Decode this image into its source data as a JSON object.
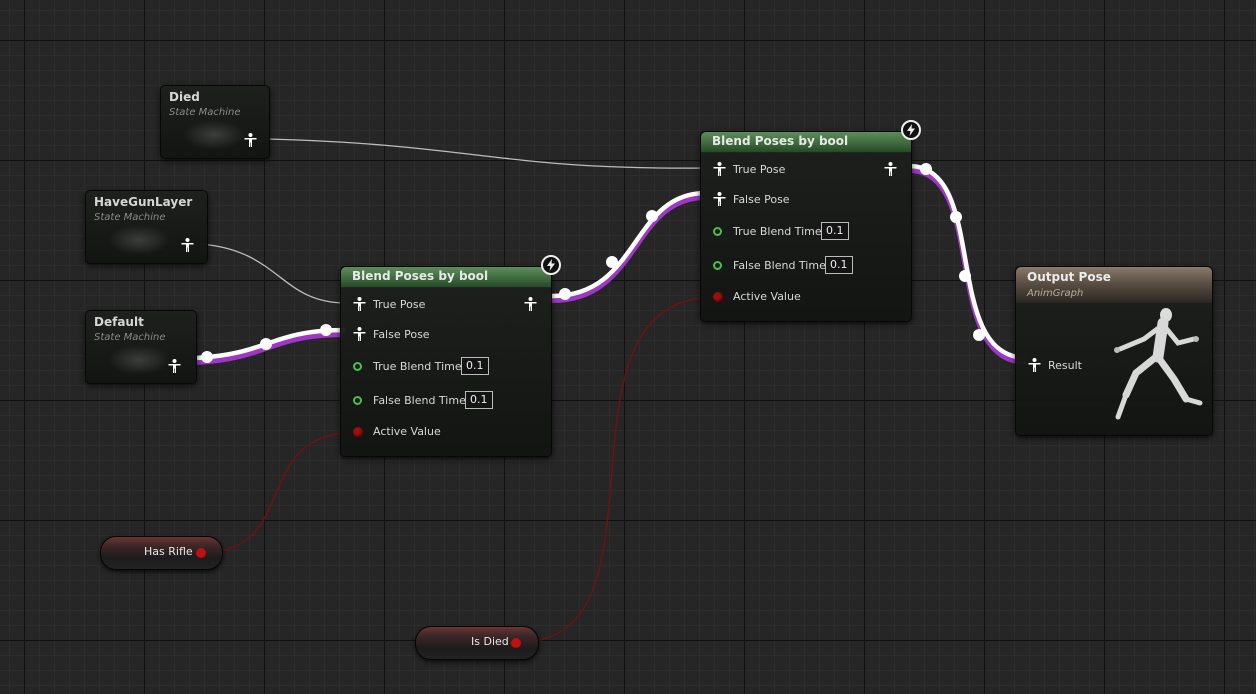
{
  "graph": {
    "state_machines": [
      {
        "id": "died",
        "title": "Died",
        "subtitle": "State Machine"
      },
      {
        "id": "havegunlayer",
        "title": "HaveGunLayer",
        "subtitle": "State Machine"
      },
      {
        "id": "default",
        "title": "Default",
        "subtitle": "State Machine"
      }
    ],
    "blend_nodes": [
      {
        "id": "blend1",
        "title": "Blend Poses by bool",
        "true_pose": "True Pose",
        "false_pose": "False Pose",
        "true_blend_time_label": "True Blend Time",
        "true_blend_time": "0.1",
        "false_blend_time_label": "False Blend Time",
        "false_blend_time": "0.1",
        "active_value": "Active Value"
      },
      {
        "id": "blend2",
        "title": "Blend Poses by bool",
        "true_pose": "True Pose",
        "false_pose": "False Pose",
        "true_blend_time_label": "True Blend Time",
        "true_blend_time": "0.1",
        "false_blend_time_label": "False Blend Time",
        "false_blend_time": "0.1",
        "active_value": "Active Value"
      }
    ],
    "output": {
      "title": "Output Pose",
      "subtitle": "AnimGraph",
      "pin": "Result"
    },
    "variables": [
      {
        "id": "has_rifle",
        "label": "Has Rifle"
      },
      {
        "id": "is_died",
        "label": "Is Died"
      }
    ]
  },
  "colors": {
    "pose_wire": "#ffffff",
    "pose_wire_underlay": "#a036c8",
    "bool_wire": "#6e1212",
    "header_green": "#4f7d4d",
    "header_output": "#7a6b5c",
    "bool_pin": "#c01010",
    "float_pin": "#49c24a"
  },
  "icons": {
    "pose_pin": "person-pose-icon",
    "fast_path": "lightning-bolt-icon",
    "preview": "mannequin-preview-icon"
  }
}
